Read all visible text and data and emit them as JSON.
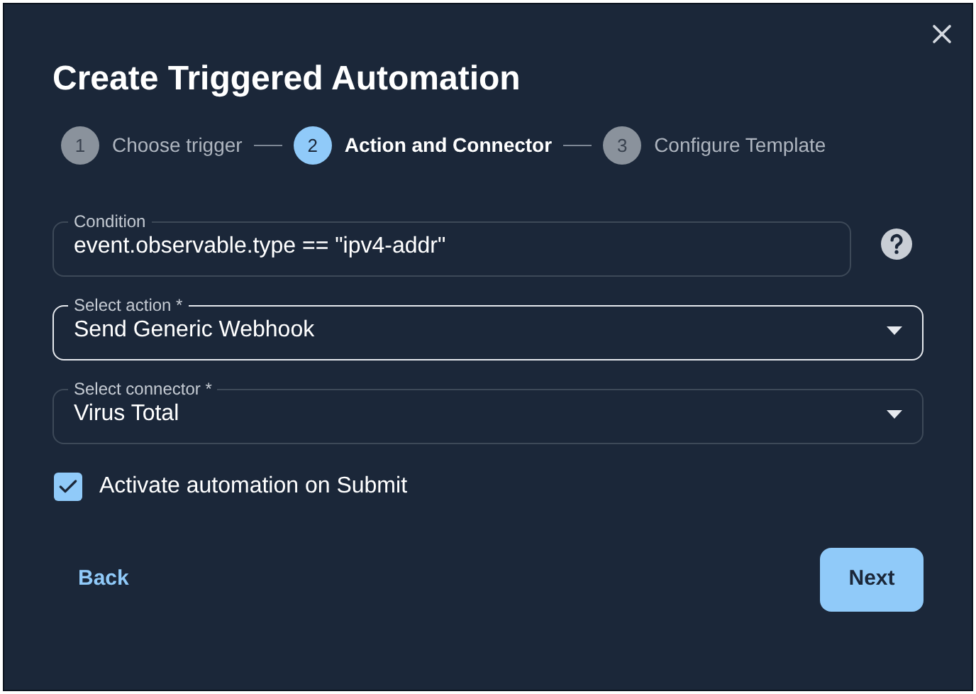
{
  "dialog": {
    "title": "Create Triggered Automation"
  },
  "steps": [
    {
      "number": "1",
      "label": "Choose trigger",
      "selected": false
    },
    {
      "number": "2",
      "label": "Action and Connector",
      "selected": true
    },
    {
      "number": "3",
      "label": "Configure Template",
      "selected": false
    }
  ],
  "fields": [
    {
      "kind": "text",
      "label": "Condition",
      "value": "event.observable.type == \"ipv4-addr\"",
      "focused": false,
      "help": true
    },
    {
      "kind": "select",
      "label": "Select action *",
      "value": "Send Generic Webhook",
      "focused": true,
      "help": false
    },
    {
      "kind": "select",
      "label": "Select connector *",
      "value": "Virus Total",
      "focused": false,
      "help": false
    }
  ],
  "activate": {
    "label": "Activate automation on Submit",
    "checked": true
  },
  "buttons": {
    "back": "Back",
    "next": "Next"
  }
}
